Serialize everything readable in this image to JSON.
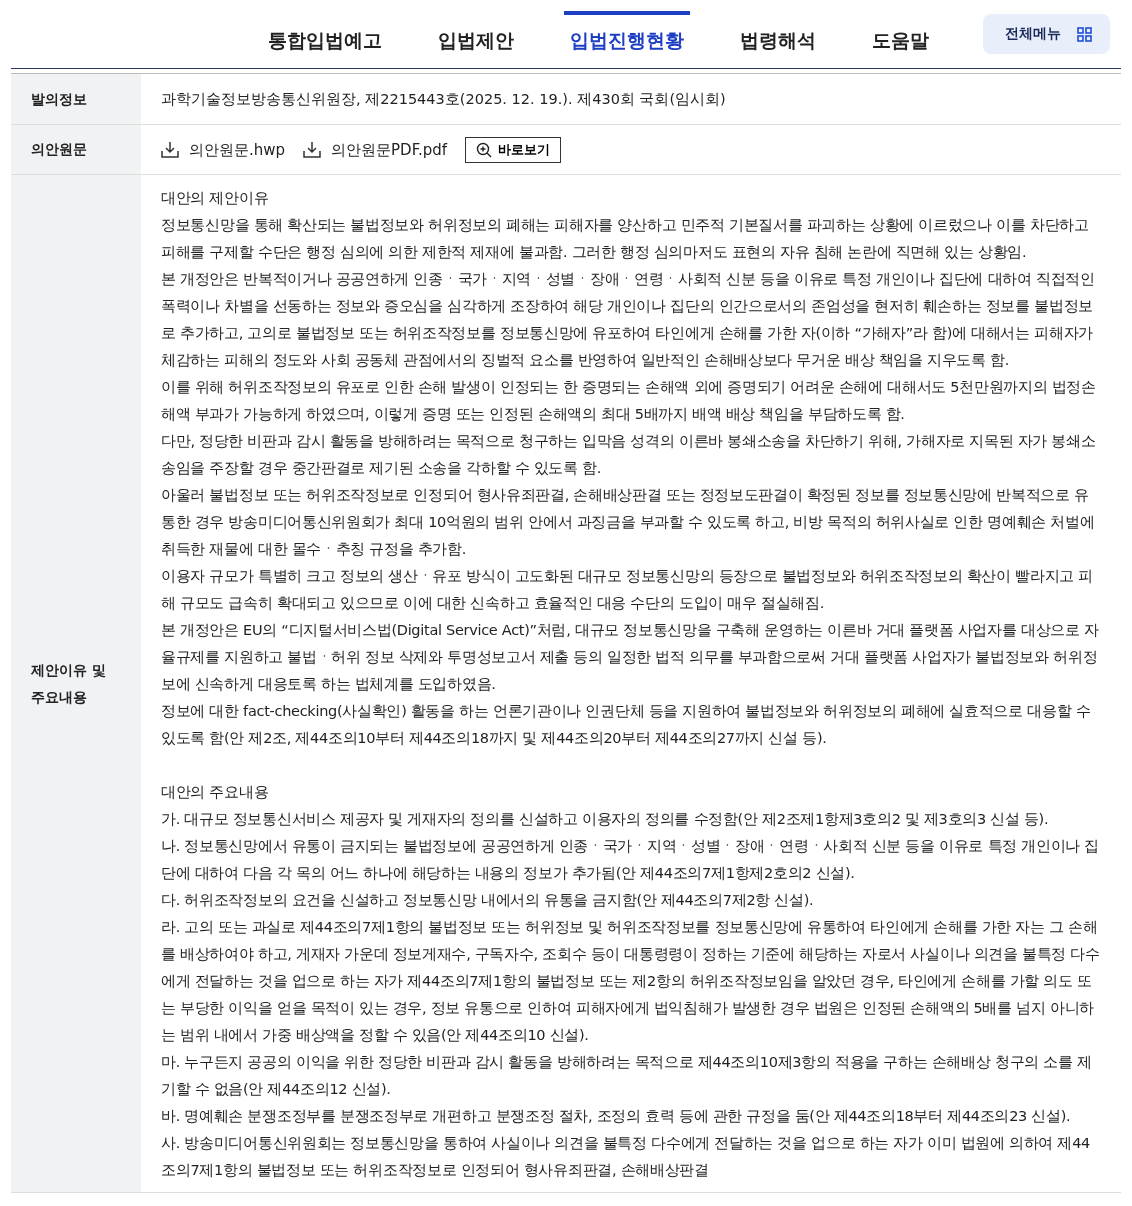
{
  "nav": {
    "tabs": [
      {
        "label": "통합입법예고",
        "selected": false
      },
      {
        "label": "입법제안",
        "selected": false
      },
      {
        "label": "입법진행현황",
        "selected": true
      },
      {
        "label": "법령해석",
        "selected": false
      },
      {
        "label": "도움말",
        "selected": false
      }
    ],
    "menu_button": "전체메뉴"
  },
  "info": {
    "proposal": {
      "label": "발의정보",
      "value": "과학기술정보방송통신위원장, 제2215443호(2025. 12. 19.). 제430회 국회(임시회)"
    },
    "original": {
      "label": "의안원문",
      "files": [
        "의안원문.hwp",
        "의안원문PDF.pdf"
      ],
      "view_button": "바로보기"
    },
    "content": {
      "label_lines": [
        "제안이유 및",
        "주요내용"
      ],
      "sections": [
        {
          "title": "대안의 제안이유",
          "paragraphs": [
            "정보통신망을 통해 확산되는 불법정보와 허위정보의 폐해는 피해자를 양산하고 민주적 기본질서를 파괴하는 상황에 이르렀으나 이를 차단하고 피해를 구제할 수단은 행정 심의에 의한 제한적 제재에 불과함. 그러한 행정 심의마저도 표현의 자유 침해 논란에 직면해 있는 상황임.",
            "본 개정안은 반복적이거나 공공연하게 인종ㆍ국가ㆍ지역ㆍ성별ㆍ장애ㆍ연령ㆍ사회적 신분 등을 이유로 특정 개인이나 집단에 대하여 직접적인 폭력이나 차별을 선동하는 정보와 증오심을 심각하게 조장하여 해당 개인이나 집단의 인간으로서의 존엄성을 현저히 훼손하는 정보를 불법정보로 추가하고, 고의로 불법정보 또는 허위조작정보를 정보통신망에 유포하여 타인에게 손해를 가한 자(이하 “가해자”라 함)에 대해서는 피해자가 체감하는 피해의 정도와 사회 공동체 관점에서의 징벌적 요소를 반영하여 일반적인 손해배상보다 무거운 배상 책임을 지우도록 함.",
            "이를 위해 허위조작정보의 유포로 인한 손해 발생이 인정되는 한 증명되는 손해액 외에 증명되기 어려운 손해에 대해서도 5천만원까지의 법정손해액 부과가 가능하게 하였으며, 이렇게 증명 또는 인정된 손해액의 최대 5배까지 배액 배상 책임을 부담하도록 함.",
            "다만, 정당한 비판과 감시 활동을 방해하려는 목적으로 청구하는 입막음 성격의 이른바 봉쇄소송을 차단하기 위해, 가해자로 지목된 자가 봉쇄소송임을 주장할 경우 중간판결로 제기된 소송을 각하할 수 있도록 함.",
            "아울러 불법정보 또는 허위조작정보로 인정되어 형사유죄판결, 손해배상판결 또는 정정보도판결이 확정된 정보를 정보통신망에 반복적으로 유통한 경우 방송미디어통신위원회가 최대 10억원의 범위 안에서 과징금을 부과할 수 있도록 하고, 비방 목적의 허위사실로 인한 명예훼손 처벌에 취득한 재물에 대한 몰수ㆍ추칭 규정을 추가함.",
            "이용자 규모가 특별히 크고 정보의 생산ㆍ유포 방식이 고도화된 대규모 정보통신망의 등장으로 불법정보와 허위조작정보의 확산이 빨라지고 피해 규모도 급속히 확대되고 있으므로 이에 대한 신속하고 효율적인 대응 수단의 도입이 매우 절실해짐.",
            "본 개정안은 EU의 “디지털서비스법(Digital Service Act)”처럼, 대규모 정보통신망을 구축해 운영하는 이른바 거대 플랫폼 사업자를 대상으로 자율규제를 지원하고 불법ㆍ허위 정보 삭제와 투명성보고서 제출 등의 일정한 법적 의무를 부과함으로써 거대 플랫폼 사업자가 불법정보와 허위정보에 신속하게 대응토록 하는 법체계를 도입하였음.",
            "정보에 대한 fact-checking(사실확인) 활동을 하는 언론기관이나 인권단체 등을 지원하여 불법정보와 허위정보의 폐해에 실효적으로 대응할 수 있도록 함(안 제2조, 제44조의10부터 제44조의18까지 및 제44조의20부터 제44조의27까지 신설 등)."
          ]
        },
        {
          "title": "대안의 주요내용",
          "paragraphs": [
            "가. 대규모 정보통신서비스 제공자 및 게재자의 정의를 신설하고 이용자의 정의를 수정함(안 제2조제1항제3호의2 및 제3호의3 신설 등).",
            "나. 정보통신망에서 유통이 금지되는 불법정보에 공공연하게 인종ㆍ국가ㆍ지역ㆍ성별ㆍ장애ㆍ연령ㆍ사회적 신분 등을 이유로 특정 개인이나 집단에 대하여 다음 각 목의 어느 하나에 해당하는 내용의 정보가 추가됨(안 제44조의7제1항제2호의2 신설).",
            "다. 허위조작정보의 요건을 신설하고 정보통신망 내에서의 유통을 금지함(안 제44조의7제2항 신설).",
            "라. 고의 또는 과실로 제44조의7제1항의 불법정보 또는 허위정보 및 허위조작정보를 정보통신망에 유통하여 타인에게 손해를 가한 자는 그 손해를 배상하여야 하고, 게재자 가운데 정보게재수, 구독자수, 조회수 등이 대통령령이 정하는 기준에 해당하는 자로서 사실이나 의견을 불특정 다수에게 전달하는 것을 업으로 하는 자가 제44조의7제1항의 불법정보 또는 제2항의 허위조작정보임을 알았던 경우, 타인에게 손해를 가할 의도 또는 부당한 이익을 얻을 목적이 있는 경우, 정보 유통으로 인하여 피해자에게 법익침해가 발생한 경우 법원은 인정된 손해액의 5배를 넘지 아니하는 범위 내에서 가중 배상액을 정할 수 있음(안 제44조의10 신설).",
            "마. 누구든지 공공의 이익을 위한 정당한 비판과 감시 활동을 방해하려는 목적으로 제44조의10제3항의 적용을 구하는 손해배상 청구의 소를 제기할 수 없음(안 제44조의12 신설).",
            "바. 명예훼손 분쟁조정부를 분쟁조정부로 개편하고 분쟁조정 절차, 조정의 효력 등에 관한 규정을 둠(안 제44조의18부터 제44조의23 신설).",
            "사. 방송미디어통신위원회는 정보통신망을 통하여 사실이나 의견을 불특정 다수에게 전달하는 것을 업으로 하는 자가 이미 법원에 의하여 제44조의7제1항의 불법정보 또는 허위조작정보로 인정되어 형사유죄판결, 손해배상판결"
          ]
        }
      ]
    }
  }
}
